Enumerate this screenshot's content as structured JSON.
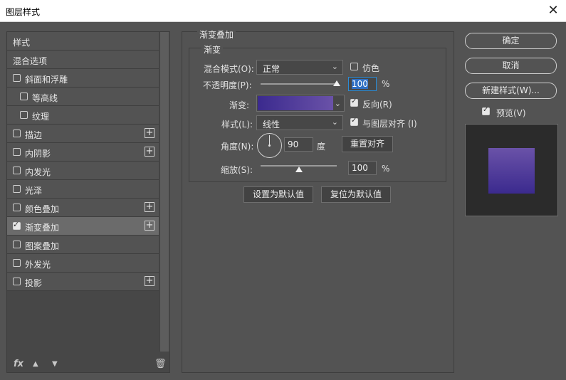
{
  "window": {
    "title": "图层样式",
    "close_icon": "close-icon"
  },
  "styles_list": {
    "items": [
      {
        "label": "样式",
        "has_checkbox": false,
        "checked": false,
        "indent": 0,
        "has_plus": false,
        "selected": false
      },
      {
        "label": "混合选项",
        "has_checkbox": false,
        "checked": false,
        "indent": 0,
        "has_plus": false,
        "selected": false
      },
      {
        "label": "斜面和浮雕",
        "has_checkbox": true,
        "checked": false,
        "indent": 0,
        "has_plus": false,
        "selected": false
      },
      {
        "label": "等高线",
        "has_checkbox": true,
        "checked": false,
        "indent": 1,
        "has_plus": false,
        "selected": false
      },
      {
        "label": "纹理",
        "has_checkbox": true,
        "checked": false,
        "indent": 1,
        "has_plus": false,
        "selected": false
      },
      {
        "label": "描边",
        "has_checkbox": true,
        "checked": false,
        "indent": 0,
        "has_plus": true,
        "selected": false
      },
      {
        "label": "内阴影",
        "has_checkbox": true,
        "checked": false,
        "indent": 0,
        "has_plus": true,
        "selected": false
      },
      {
        "label": "内发光",
        "has_checkbox": true,
        "checked": false,
        "indent": 0,
        "has_plus": false,
        "selected": false
      },
      {
        "label": "光泽",
        "has_checkbox": true,
        "checked": false,
        "indent": 0,
        "has_plus": false,
        "selected": false
      },
      {
        "label": "颜色叠加",
        "has_checkbox": true,
        "checked": false,
        "indent": 0,
        "has_plus": true,
        "selected": false
      },
      {
        "label": "渐变叠加",
        "has_checkbox": true,
        "checked": true,
        "indent": 0,
        "has_plus": true,
        "selected": true
      },
      {
        "label": "图案叠加",
        "has_checkbox": true,
        "checked": false,
        "indent": 0,
        "has_plus": false,
        "selected": false
      },
      {
        "label": "外发光",
        "has_checkbox": true,
        "checked": false,
        "indent": 0,
        "has_plus": false,
        "selected": false
      },
      {
        "label": "投影",
        "has_checkbox": true,
        "checked": false,
        "indent": 0,
        "has_plus": true,
        "selected": false
      }
    ],
    "tools": {
      "fx": "fx",
      "up": "▲",
      "down": "▼",
      "trash": "🗑"
    }
  },
  "gradient_overlay": {
    "section_title": "渐变叠加",
    "group_title": "渐变",
    "blend_mode_label": "混合模式(O):",
    "blend_mode_value": "正常",
    "dither_label": "仿色",
    "dither_checked": false,
    "opacity_label": "不透明度(P):",
    "opacity_value": "100",
    "opacity_unit": "%",
    "opacity_level": 1.0,
    "gradient_label": "渐变:",
    "gradient_colors": [
      "#3b2a8e",
      "#6a52a8"
    ],
    "reverse_label": "反向(R)",
    "reverse_checked": true,
    "style_label": "样式(L):",
    "style_value": "线性",
    "align_label": "与图层对齐 (I)",
    "align_checked": true,
    "angle_label": "角度(N):",
    "angle_value": "90",
    "angle_unit": "度",
    "reset_align_button": "重置对齐",
    "scale_label": "缩放(S):",
    "scale_value": "100",
    "scale_unit": "%",
    "scale_level": 0.5,
    "set_default_button": "设置为默认值",
    "reset_default_button": "复位为默认值"
  },
  "actions": {
    "ok": "确定",
    "cancel": "取消",
    "new_style": "新建样式(W)...",
    "preview_label": "预览(V)",
    "preview_checked": true
  },
  "preview": {
    "swatch_colors": [
      "#6a52a8",
      "#3b2a8e"
    ],
    "frame_color": "#2b2b2b"
  }
}
